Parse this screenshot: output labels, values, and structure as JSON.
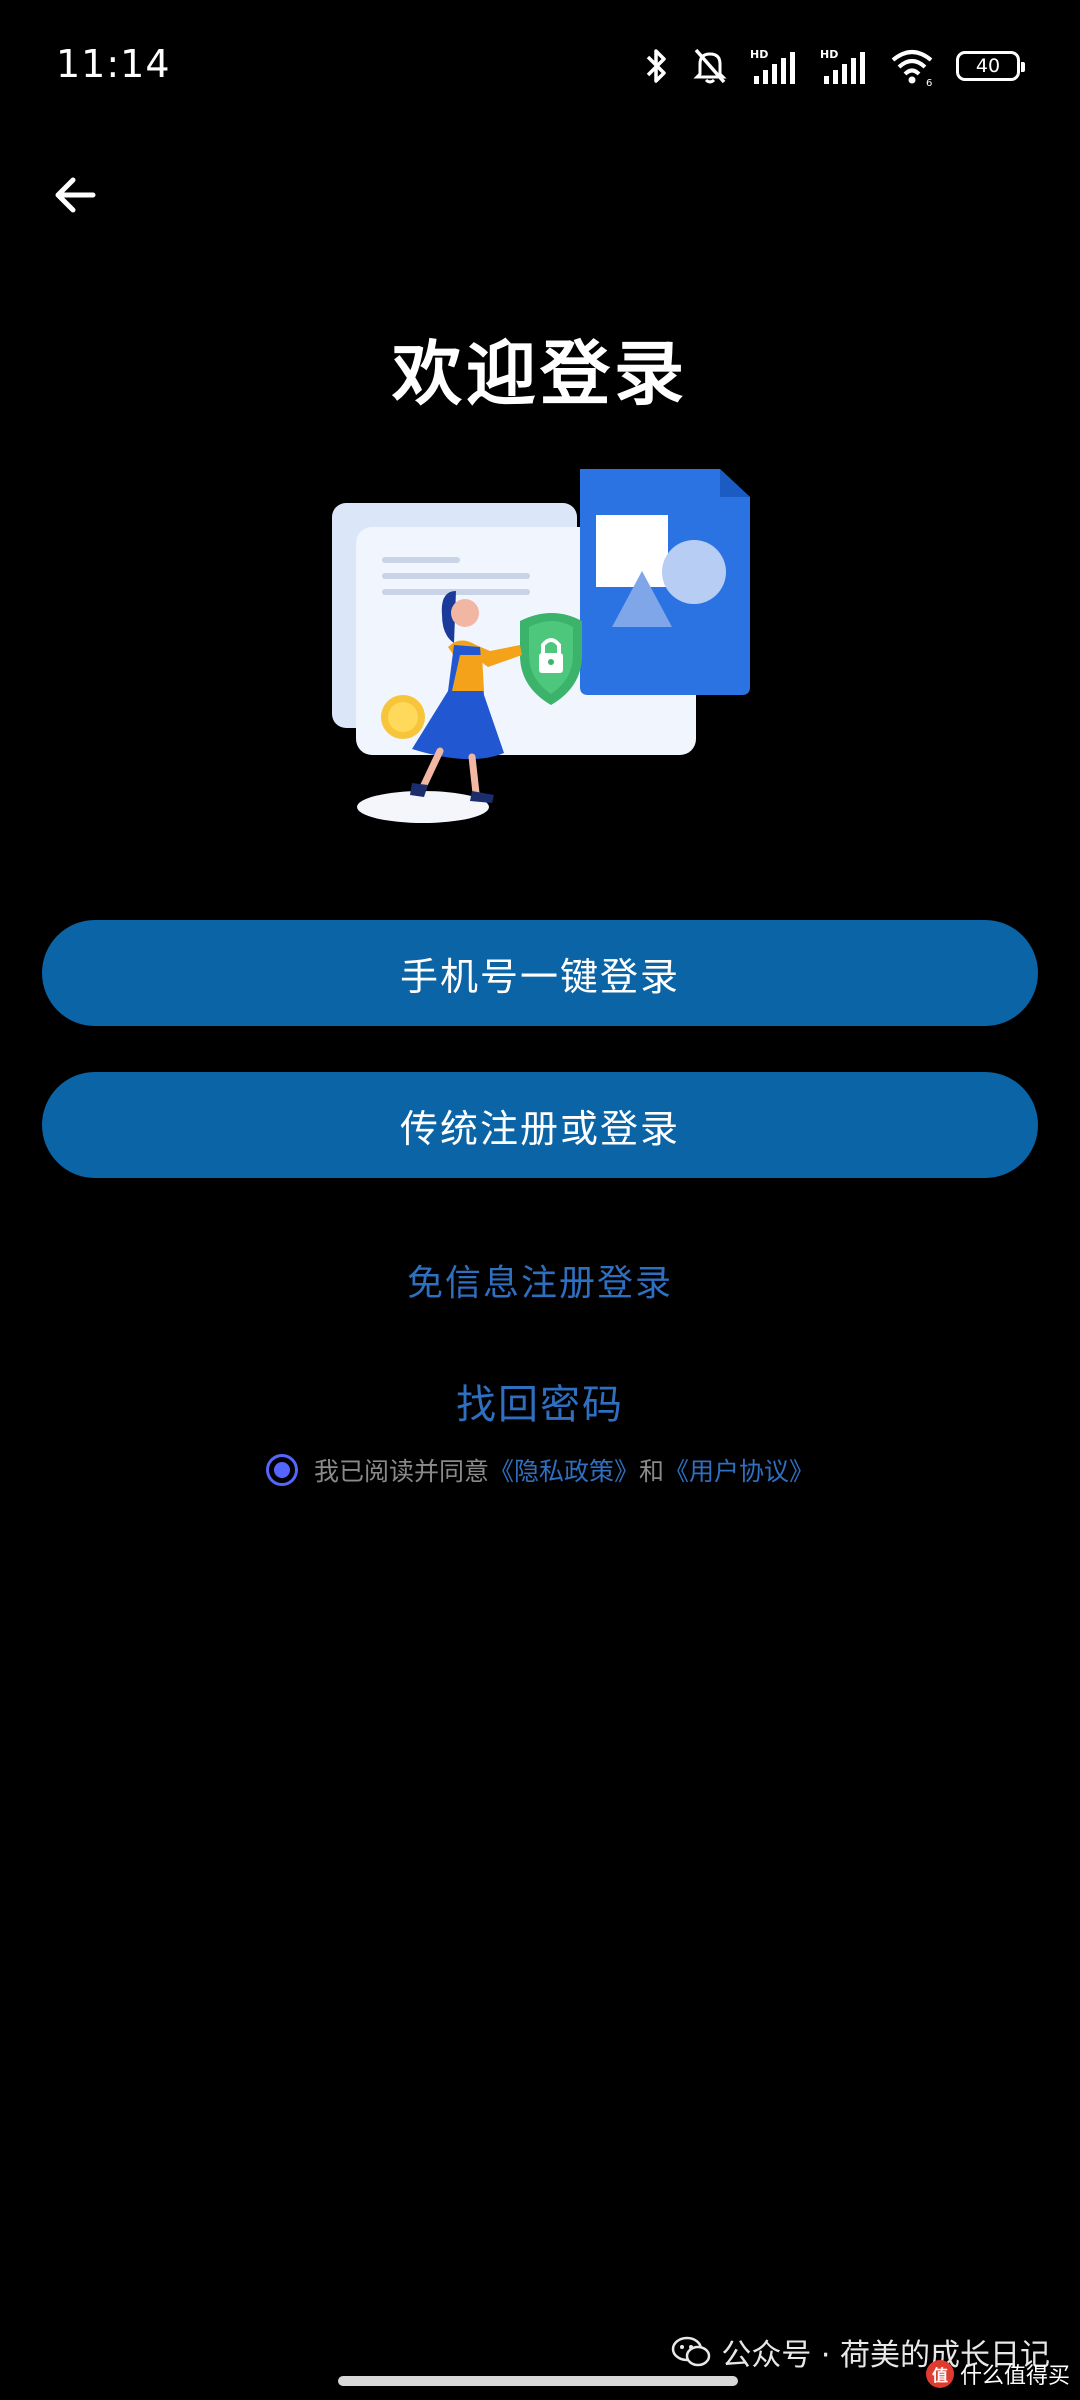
{
  "status_bar": {
    "time": "11:14",
    "battery": "40",
    "icons": [
      "bluetooth-icon",
      "mute-bell-icon",
      "hd-signal-icon",
      "hd-signal-icon",
      "wifi-icon",
      "battery-icon"
    ]
  },
  "header": {
    "back_icon": "arrow-left-icon",
    "title": "欢迎登录"
  },
  "actions": {
    "phone_login": "手机号一键登录",
    "traditional_login": "传统注册或登录",
    "free_register": "免信息注册登录",
    "forgot_password": "找回密码"
  },
  "agreement": {
    "checked": true,
    "prefix": "我已阅读并同意",
    "privacy_policy": "《隐私政策》",
    "connector": "和",
    "user_agreement": "《用户协议》"
  },
  "watermark": {
    "text": "公众号 · 荷美的成长日记",
    "corner_text": "什么值得买",
    "corner_logo": "值"
  },
  "colors": {
    "background": "#000000",
    "button": "#0a64a6",
    "link": "#2f6fc0",
    "radio": "#5566ff"
  }
}
